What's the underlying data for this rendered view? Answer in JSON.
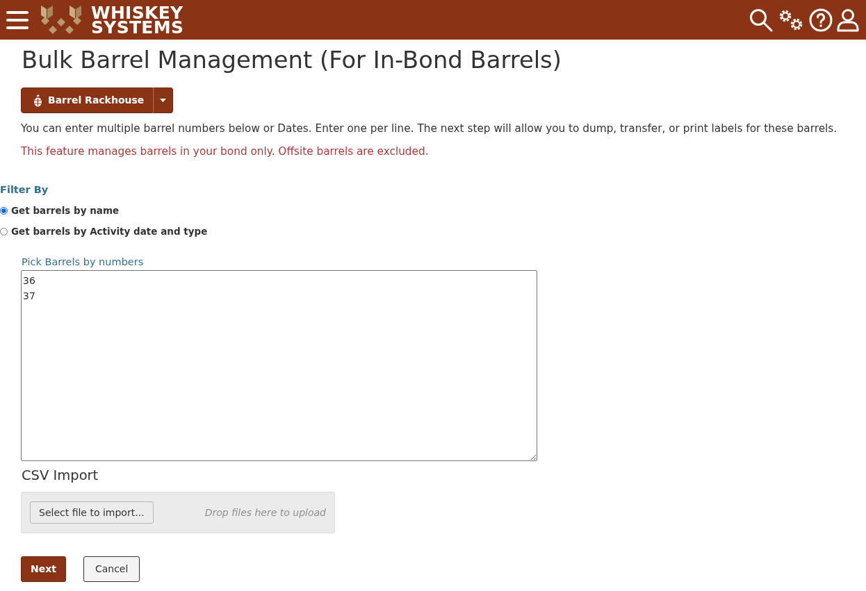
{
  "header": {
    "logo": {
      "line_1": "WHISKEY",
      "line_2": "SYSTEMS"
    }
  },
  "title": "Bulk Barrel Management (For In-Bond Barrels)",
  "location_button": {
    "label": "Barrel Rackhouse"
  },
  "info_text": "You can enter multiple barrel numbers below or Dates. Enter one per line. The next step will allow you to dump, transfer, or print labels for these barrels.",
  "warning_text": "This feature manages barrels in your bond only. Offsite barrels are excluded.",
  "filter": {
    "label": "Filter By",
    "options": [
      {
        "label": "Get barrels by name",
        "selected": true
      },
      {
        "label": "Get barrels by Activity date and type",
        "selected": false
      }
    ]
  },
  "barrel_numbers": {
    "label": "Pick Barrels by numbers",
    "value": "36\n37"
  },
  "csv_import": {
    "title": "CSV Import",
    "button": "Select file to import...",
    "drop_hint": "Drop files here to upload"
  },
  "actions": [
    {
      "label": "Next",
      "kind": "primary"
    },
    {
      "label": "Cancel",
      "kind": "secondary"
    }
  ]
}
